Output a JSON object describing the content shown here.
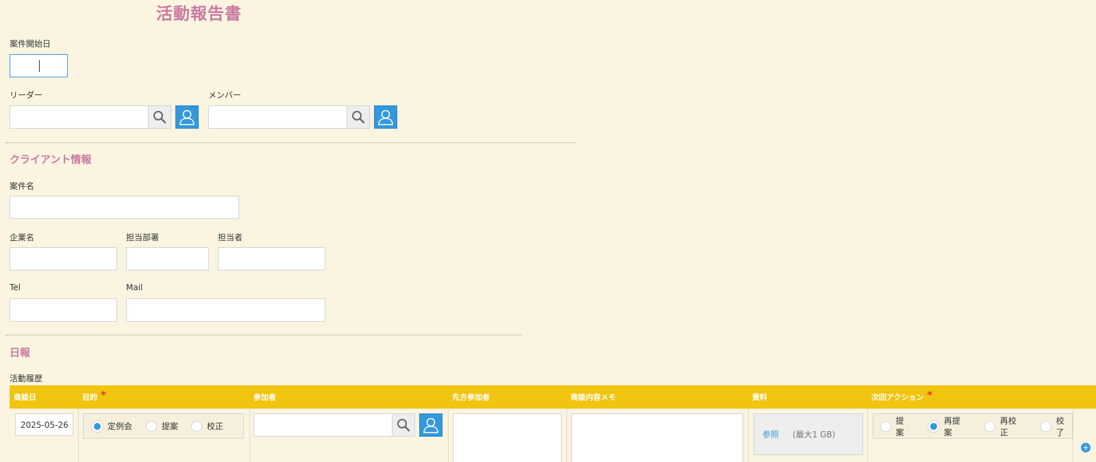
{
  "page": {
    "title": "活動報告書"
  },
  "fields": {
    "start_date_label": "案件開始日",
    "leader_label": "リーダー",
    "member_label": "メンバー"
  },
  "client_section": {
    "title": "クライアント情報",
    "project_name_label": "案件名",
    "company_label": "企業名",
    "department_label": "担当部署",
    "person_label": "担当者",
    "tel_label": "Tel",
    "mail_label": "Mail"
  },
  "daily_section": {
    "title": "日報",
    "history_label": "活動履歴"
  },
  "table": {
    "columns": [
      "商談日",
      "目的",
      "参加者",
      "先方参加者",
      "商談内容メモ",
      "資料",
      "次回アクション"
    ],
    "required_mark": "*",
    "row": {
      "date": "2025-05-26",
      "purpose_options": [
        "定例会",
        "提案",
        "校正"
      ],
      "purpose_selected": "定例会",
      "file_browse": "参照",
      "file_limit": "(最大1 GB)",
      "next_action_options": [
        "提案",
        "再提案",
        "再校正",
        "校了"
      ],
      "next_action_selected": "再提案"
    }
  },
  "colors": {
    "background": "#faf4e1",
    "accent_title": "#c979a0",
    "header_yellow": "#f1c40f",
    "button_blue": "#3498db"
  },
  "icons": [
    "search-icon",
    "user-icon",
    "add-row-icon"
  ]
}
